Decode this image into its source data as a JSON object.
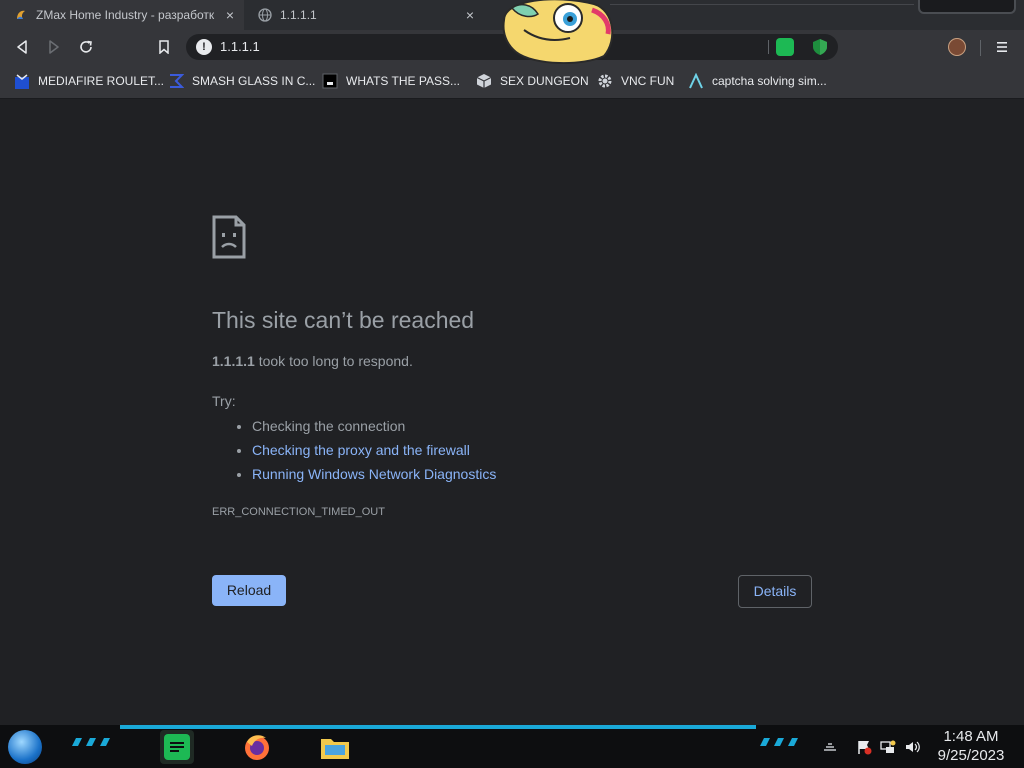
{
  "tabs": [
    {
      "title": "ZMax Home Industry - разработк",
      "icon": "zmax-favicon",
      "close": "×"
    },
    {
      "title": "1.1.1.1",
      "icon": "globe-icon",
      "close": "×"
    }
  ],
  "toolbar": {
    "url": "1.1.1.1",
    "info_glyph": "!"
  },
  "bookmarks": [
    {
      "label": "MEDIAFIRE ROULET...",
      "icon": "mediafire-icon"
    },
    {
      "label": "SMASH GLASS IN C...",
      "icon": "sigma-icon"
    },
    {
      "label": "WHATS THE PASS...",
      "icon": "dark-square-icon"
    },
    {
      "label": "SEX DUNGEON",
      "icon": "cube-icon"
    },
    {
      "label": "VNC FUN",
      "icon": "gear-icon"
    },
    {
      "label": "captcha solving sim...",
      "icon": "lambda-icon"
    }
  ],
  "error": {
    "title": "This site can’t be reached",
    "host": "1.1.1.1",
    "message": " took too long to respond.",
    "try_label": "Try:",
    "suggestions": [
      "Checking the connection",
      "Checking the proxy and the firewall",
      "Running Windows Network Diagnostics"
    ],
    "code": "ERR_CONNECTION_TIMED_OUT",
    "reload_label": "Reload",
    "details_label": "Details"
  },
  "taskbar": {
    "time": "1:48 AM",
    "date": "9/25/2023"
  },
  "colors": {
    "background": "#202124",
    "link": "#8ab4f8",
    "accent": "#1aa9d8"
  }
}
